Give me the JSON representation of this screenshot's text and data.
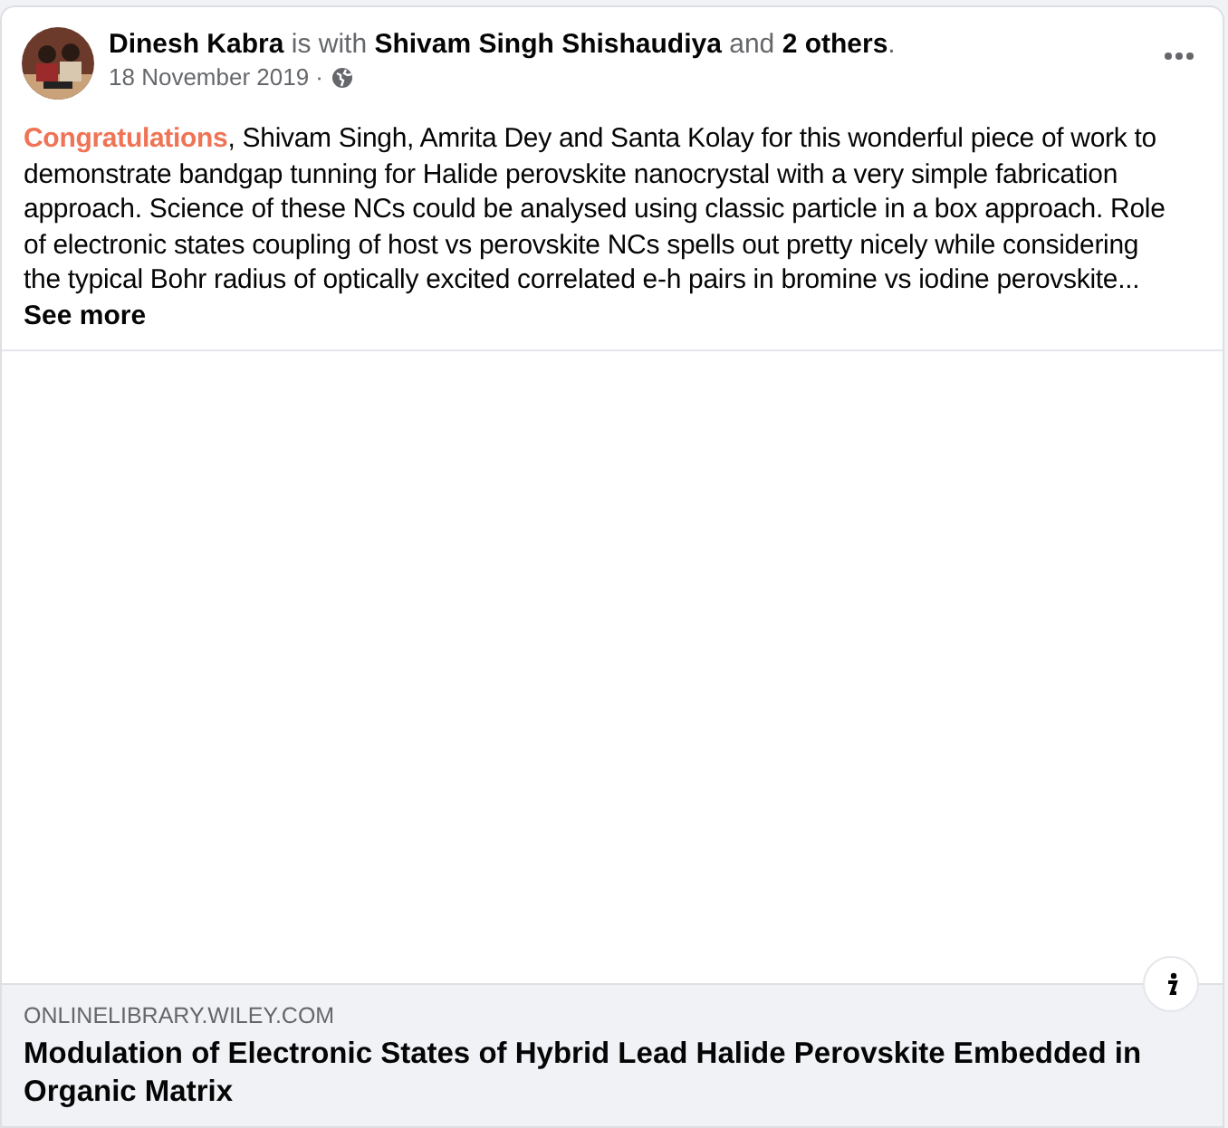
{
  "post": {
    "header": "**Dinesh Kabra** is with **Shivam Singh Shishaudiya** and **2 others**.",
    "date": "18 November 2019 ·",
    "body": "**Congratulations**, Shivam Singh, Amrita Dey and Santa Kolay for this wonderful piece of work to demonstrate bandgap tunning for Halide perovskite nanocrystal with a very simple fabrication approach. Science of these NCs could be analysed using classic particle in a box approach.  Role of electronic states coupling of host vs perovskite NCs spells out pretty nicely while considering the typical Bohr radius of optically excited correlated e-h pairs in bromine vs iodine perovskite...",
    "see_more": "See more"
  },
  "link": {
    "domain": "ONLINELIBRARY.WILEY.COM",
    "title": "Modulation of Electronic States of Hybrid Lead Halide Perovskite Embedded in Organic Matrix"
  }
}
